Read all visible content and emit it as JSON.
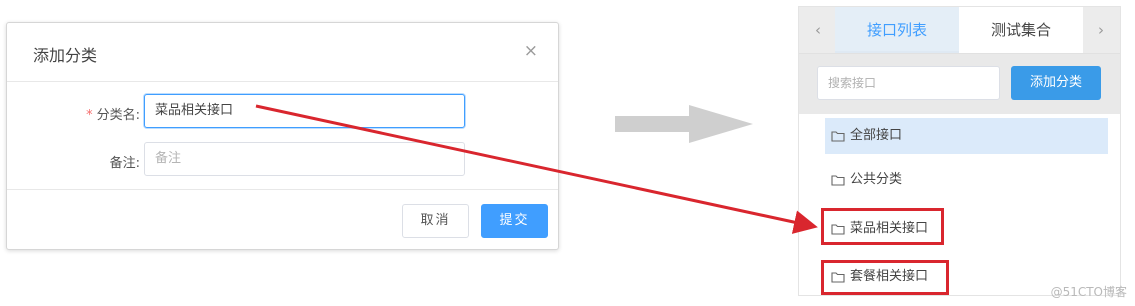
{
  "dialog": {
    "title": "添加分类",
    "close_glyph": "×",
    "fields": [
      {
        "label": "分类名:",
        "required_mark": "*",
        "value": "菜品相关接口",
        "placeholder": ""
      },
      {
        "label": "备注:",
        "value": "",
        "placeholder": "备注"
      }
    ],
    "buttons": {
      "cancel": "取消",
      "submit": "提交"
    }
  },
  "panel": {
    "tabs": {
      "prev_glyph": "‹",
      "next_glyph": "›",
      "items": [
        "接口列表",
        "测试集合"
      ],
      "active_index": 0
    },
    "search": {
      "placeholder": "搜索接口"
    },
    "add_button": "添加分类",
    "tree_items": [
      "全部接口",
      "公共分类",
      "菜品相关接口",
      "套餐相关接口"
    ],
    "selected_item": "全部接口"
  },
  "colors": {
    "accent": "#409eff",
    "highlight": "#d9262e",
    "required": "#f56c6c",
    "arrow": "#cfcfcf"
  },
  "icons": [
    "close-icon",
    "chevron-left-icon",
    "chevron-right-icon",
    "folder-icon",
    "arrow-right-icon"
  ],
  "watermark": "@51CTO博客"
}
